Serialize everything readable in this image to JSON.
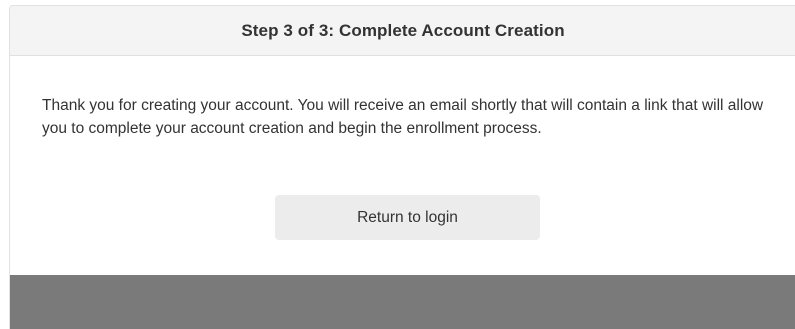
{
  "card": {
    "title": "Step 3 of 3: Complete Account Creation",
    "message": "Thank you for creating your account. You will receive an email shortly that will contain a link that will allow you to complete your account creation and begin the enrollment process.",
    "return_button_label": "Return to login"
  },
  "colors": {
    "header_background": "#f4f4f4",
    "button_background": "#ececec",
    "footer_background": "#7a7a7a",
    "text": "#333333"
  }
}
